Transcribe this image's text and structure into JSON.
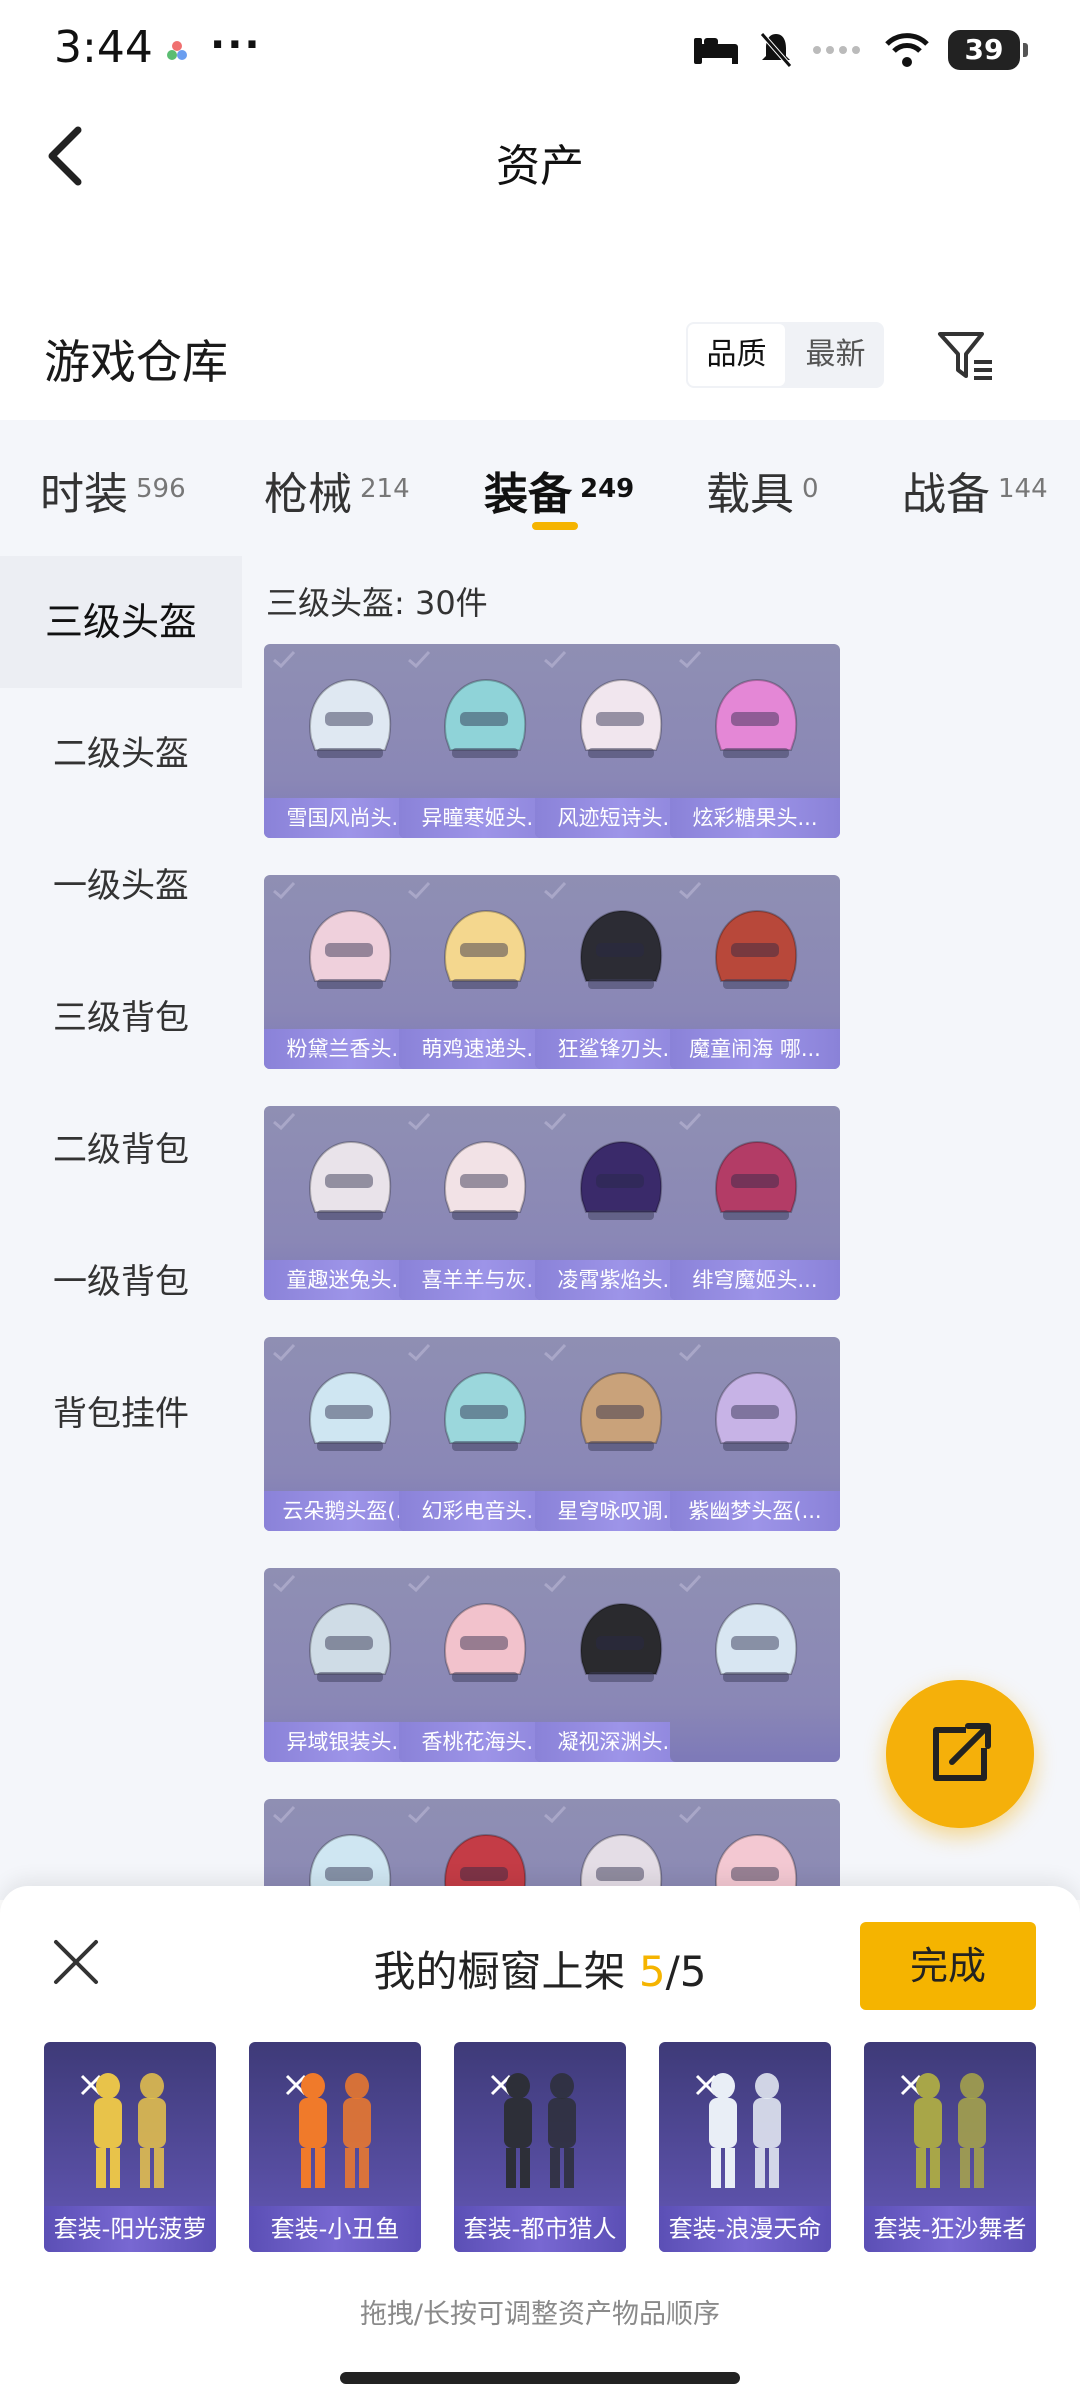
{
  "status": {
    "time": "3:44",
    "more": "···",
    "battery": "39"
  },
  "nav": {
    "title": "资产"
  },
  "header": {
    "title": "游戏仓库",
    "sort_options": [
      "品质",
      "最新"
    ]
  },
  "categories": [
    {
      "label": "时装",
      "count": "596"
    },
    {
      "label": "枪械",
      "count": "214"
    },
    {
      "label": "装备",
      "count": "249",
      "active": true
    },
    {
      "label": "载具",
      "count": "0"
    },
    {
      "label": "战备",
      "count": "144"
    }
  ],
  "sidebar": {
    "items": [
      "三级头盔",
      "二级头盔",
      "一级头盔",
      "三级背包",
      "二级背包",
      "一级背包",
      "背包挂件"
    ]
  },
  "grid": {
    "title": "三级头盔: 30件",
    "items": [
      {
        "name": "雪国风尚头...",
        "color": "#dfe8f2"
      },
      {
        "name": "异瞳寒姬头...",
        "color": "#8fd3d8"
      },
      {
        "name": "风迹短诗头...",
        "color": "#f1e6ee"
      },
      {
        "name": "炫彩糖果头...",
        "color": "#e487d6"
      },
      {
        "name": "粉黛兰香头...",
        "color": "#efd0dc"
      },
      {
        "name": "萌鸡速递头...",
        "color": "#f4d78e"
      },
      {
        "name": "狂鲨锋刃头...",
        "color": "#2c2c34"
      },
      {
        "name": "魔童闹海 哪...",
        "color": "#b8483a"
      },
      {
        "name": "童趣迷兔头...",
        "color": "#e9e3ea"
      },
      {
        "name": "喜羊羊与灰...",
        "color": "#f2e2e6"
      },
      {
        "name": "凌霄紫焰头...",
        "color": "#3a2a6a"
      },
      {
        "name": "绯穹魔姬头...",
        "color": "#b33c66"
      },
      {
        "name": "云朵鹅头盔(...",
        "color": "#cfe6f2"
      },
      {
        "name": "幻彩电音头...",
        "color": "#9bd7dc"
      },
      {
        "name": "星穹咏叹调...",
        "color": "#c9a27a"
      },
      {
        "name": "紫幽梦头盔(...",
        "color": "#c7b3e6"
      },
      {
        "name": "异域银装头...",
        "color": "#cfdce6"
      },
      {
        "name": "香桃花海头...",
        "color": "#f2c2cc"
      },
      {
        "name": "凝视深渊头...",
        "color": "#2a2a2e"
      },
      {
        "name": "",
        "color": "#d8e6f2"
      },
      {
        "name": "",
        "color": "#cfe6f2"
      },
      {
        "name": "",
        "color": "#c43c46"
      },
      {
        "name": "",
        "color": "#e4dde6"
      },
      {
        "name": "",
        "color": "#f3c8d2"
      }
    ]
  },
  "showcase": {
    "title_prefix": "我的橱窗上架",
    "current": "5",
    "total": "/5",
    "done_label": "完成",
    "items": [
      {
        "name": "套装-阳光菠萝",
        "color": "#e8c34a"
      },
      {
        "name": "套装-小丑鱼",
        "color": "#f07a2a"
      },
      {
        "name": "套装-都市猎人",
        "color": "#2d2f38"
      },
      {
        "name": "套装-浪漫天命",
        "color": "#e9eef6"
      },
      {
        "name": "套装-狂沙舞者",
        "color": "#a8a648"
      }
    ],
    "hint": "拖拽/长按可调整资产物品顺序"
  },
  "icons": {
    "back": "back-arrow-icon",
    "filter": "filter-icon",
    "share": "share-icon",
    "close": "close-icon"
  }
}
